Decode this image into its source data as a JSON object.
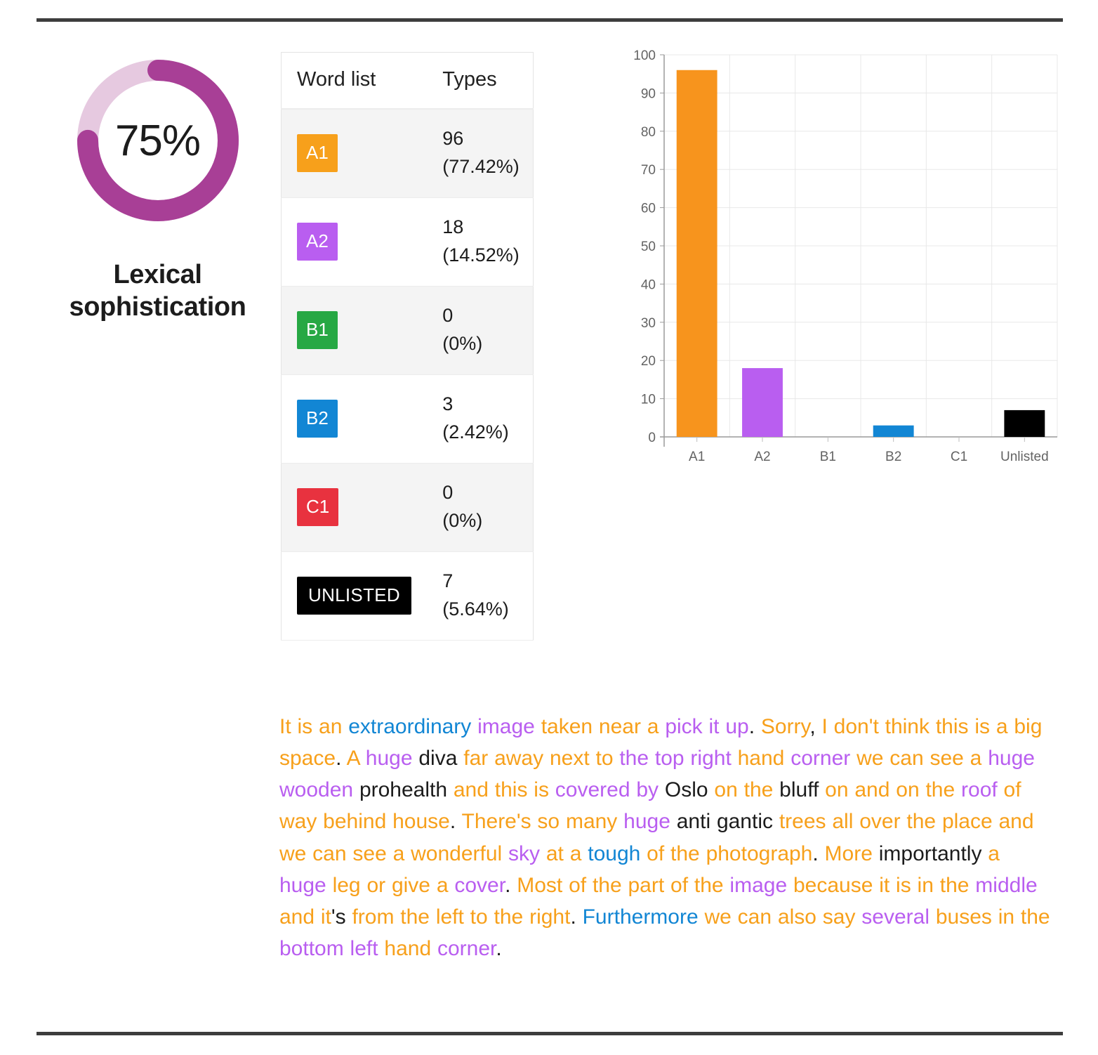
{
  "gauge": {
    "percent_label": "75%",
    "percent_value": 75,
    "title_line1": "Lexical",
    "title_line2": "sophistication",
    "track_color": "#e6c9e0",
    "fill_color": "#a83f96"
  },
  "table": {
    "headers": [
      "Word list",
      "Types"
    ],
    "rows": [
      {
        "label": "A1",
        "color": "#f7a01b",
        "count": "96",
        "percent": "(77.42%)"
      },
      {
        "label": "A2",
        "color": "#b95ef0",
        "count": "18",
        "percent": "(14.52%)"
      },
      {
        "label": "B1",
        "color": "#27a844",
        "count": "0",
        "percent": "(0%)"
      },
      {
        "label": "B2",
        "color": "#1286d4",
        "count": "3",
        "percent": "(2.42%)"
      },
      {
        "label": "C1",
        "color": "#e8323f",
        "count": "0",
        "percent": "(0%)"
      },
      {
        "label": "UNLISTED",
        "color": "#000000",
        "count": "7",
        "percent": "(5.64%)"
      }
    ]
  },
  "chart_data": {
    "type": "bar",
    "title": "",
    "xlabel": "",
    "ylabel": "",
    "categories": [
      "A1",
      "A2",
      "B1",
      "B2",
      "C1",
      "Unlisted"
    ],
    "values": [
      96,
      18,
      0,
      3,
      0,
      7
    ],
    "colors": [
      "#f7941d",
      "#b95ef0",
      "#27a844",
      "#1286d4",
      "#e8323f",
      "#000000"
    ],
    "ylim": [
      0,
      100
    ],
    "yticks": [
      0,
      10,
      20,
      30,
      40,
      50,
      60,
      70,
      80,
      90,
      100
    ],
    "ytick_labels": [
      "0",
      "10",
      "20",
      "30",
      "40",
      "50",
      "60",
      "70",
      "80",
      "90",
      "100"
    ],
    "grid": true,
    "legend": "none"
  },
  "transcript": {
    "colors": {
      "a1": "#f7a01b",
      "a2": "#b95ef0",
      "b1": "#27a844",
      "b2": "#1286d4",
      "c1": "#e8323f",
      "unlisted": "#1c1c1c"
    },
    "tokens": [
      {
        "t": "It is an ",
        "c": "a1"
      },
      {
        "t": "extraordinary ",
        "c": "b2"
      },
      {
        "t": "image ",
        "c": "a2"
      },
      {
        "t": "taken near a ",
        "c": "a1"
      },
      {
        "t": "pick it up",
        "c": "a2"
      },
      {
        "t": ". ",
        "c": "unlisted"
      },
      {
        "t": "Sorry",
        "c": "a1"
      },
      {
        "t": ", ",
        "c": "unlisted"
      },
      {
        "t": "I don't think this is a big space",
        "c": "a1"
      },
      {
        "t": ". ",
        "c": "unlisted"
      },
      {
        "t": "A ",
        "c": "a1"
      },
      {
        "t": "huge ",
        "c": "a2"
      },
      {
        "t": "diva ",
        "c": "unlisted"
      },
      {
        "t": "far away next to ",
        "c": "a1"
      },
      {
        "t": "the top right ",
        "c": "a2"
      },
      {
        "t": "hand ",
        "c": "a1"
      },
      {
        "t": "corner ",
        "c": "a2"
      },
      {
        "t": "we can see a ",
        "c": "a1"
      },
      {
        "t": "huge wooden ",
        "c": "a2"
      },
      {
        "t": "prohealth ",
        "c": "unlisted"
      },
      {
        "t": "and this is ",
        "c": "a1"
      },
      {
        "t": "covered by ",
        "c": "a2"
      },
      {
        "t": "Oslo ",
        "c": "unlisted"
      },
      {
        "t": "on the ",
        "c": "a1"
      },
      {
        "t": "bluff ",
        "c": "unlisted"
      },
      {
        "t": "on and on the ",
        "c": "a1"
      },
      {
        "t": "roof ",
        "c": "a2"
      },
      {
        "t": "of way behind house",
        "c": "a1"
      },
      {
        "t": ". ",
        "c": "unlisted"
      },
      {
        "t": "There's so many ",
        "c": "a1"
      },
      {
        "t": "huge ",
        "c": "a2"
      },
      {
        "t": "anti gantic ",
        "c": "unlisted"
      },
      {
        "t": "trees all over the place and we can see a wonderful ",
        "c": "a1"
      },
      {
        "t": "sky ",
        "c": "a2"
      },
      {
        "t": "at a ",
        "c": "a1"
      },
      {
        "t": "tough ",
        "c": "b2"
      },
      {
        "t": "of the photograph",
        "c": "a1"
      },
      {
        "t": ". ",
        "c": "unlisted"
      },
      {
        "t": "More ",
        "c": "a1"
      },
      {
        "t": "importantly ",
        "c": "unlisted"
      },
      {
        "t": "a ",
        "c": "a1"
      },
      {
        "t": "huge ",
        "c": "a2"
      },
      {
        "t": "leg or give a ",
        "c": "a1"
      },
      {
        "t": "cover",
        "c": "a2"
      },
      {
        "t": ". ",
        "c": "unlisted"
      },
      {
        "t": "Most of the part of the ",
        "c": "a1"
      },
      {
        "t": "image ",
        "c": "a2"
      },
      {
        "t": "because it is in the ",
        "c": "a1"
      },
      {
        "t": "middle ",
        "c": "a2"
      },
      {
        "t": "and it",
        "c": "a1"
      },
      {
        "t": "'s ",
        "c": "unlisted"
      },
      {
        "t": "from the left to the right",
        "c": "a1"
      },
      {
        "t": ". ",
        "c": "unlisted"
      },
      {
        "t": "Furthermore ",
        "c": "b2"
      },
      {
        "t": "we can also say ",
        "c": "a1"
      },
      {
        "t": "several ",
        "c": "a2"
      },
      {
        "t": "buses ",
        "c": "a1"
      },
      {
        "t": "in the ",
        "c": "a1"
      },
      {
        "t": "bottom left ",
        "c": "a2"
      },
      {
        "t": "hand ",
        "c": "a1"
      },
      {
        "t": "corner",
        "c": "a2"
      },
      {
        "t": ".",
        "c": "unlisted"
      }
    ]
  }
}
